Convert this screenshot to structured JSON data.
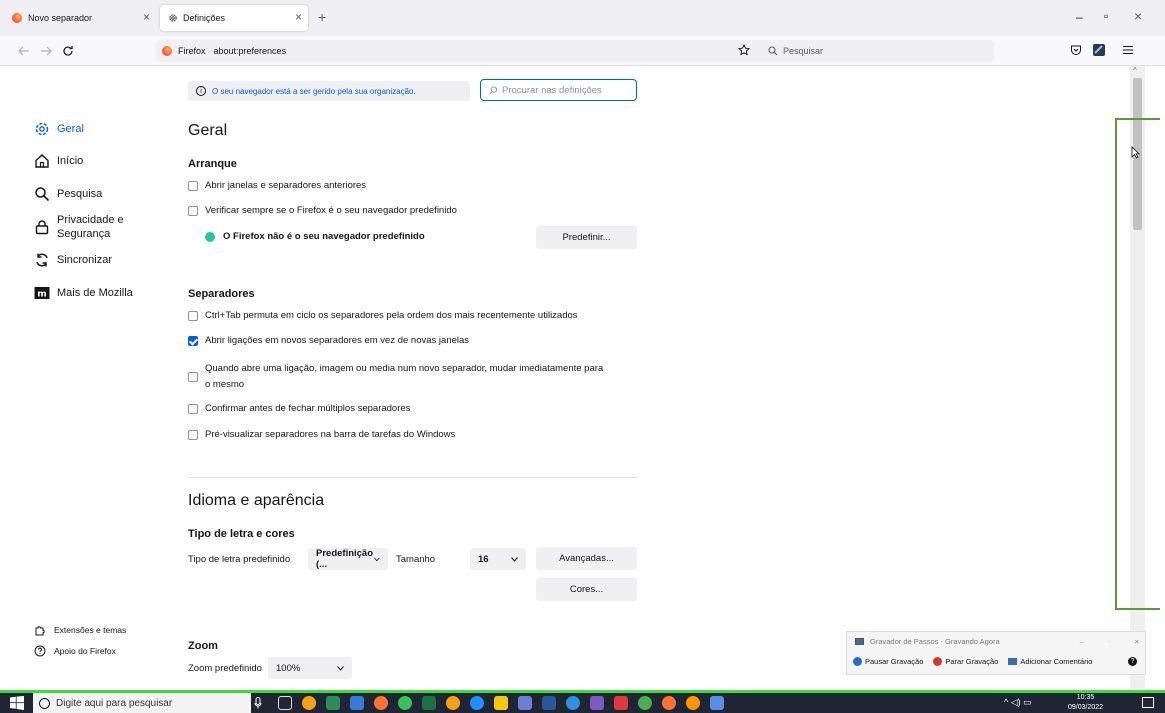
{
  "tabs": [
    {
      "label": "Novo separador",
      "close": "×"
    },
    {
      "label": "Definições",
      "close": "×"
    }
  ],
  "new_tab": "+",
  "window_controls": {
    "minimize": "–",
    "maximize": "▫",
    "close": "×"
  },
  "url": {
    "identity": "Firefox",
    "address": "about:preferences"
  },
  "search": {
    "placeholder": "Pesquisar"
  },
  "managed_notice": "O seu navegador está a ser gerido pela sua organização.",
  "settings_search": {
    "placeholder": "Procurar nas definições"
  },
  "sidebar": {
    "items": [
      {
        "label": "Geral",
        "icon": "gear-icon"
      },
      {
        "label": "Início",
        "icon": "home-icon"
      },
      {
        "label": "Pesquisa",
        "icon": "search-icon"
      },
      {
        "label": "Privacidade e",
        "label2": "Segurança",
        "icon": "lock-icon"
      },
      {
        "label": "Sincronizar",
        "icon": "sync-icon"
      },
      {
        "label": "Mais de Mozilla",
        "icon": "mozilla-icon"
      }
    ],
    "footer": [
      {
        "label": "Extensões e temas",
        "icon": "puzzle-icon"
      },
      {
        "label": "Apoio do Firefox",
        "icon": "help-icon"
      }
    ]
  },
  "general": {
    "title": "Geral",
    "startup": {
      "heading": "Arranque",
      "restore": "Abrir janelas e separadores anteriores",
      "check_default": "Verificar sempre se o Firefox é o seu navegador predefinido",
      "not_default": "O Firefox não é o seu navegador predefinido",
      "make_default": "Predefinir..."
    },
    "tabs": {
      "heading": "Separadores",
      "ctrl_tab": "Ctrl+Tab permuta em ciclo os separadores pela ordem dos mais recentemente utilizados",
      "open_links": "Abrir ligações em novos separadores em vez de novas janelas",
      "switch_line1": "Quando abre uma ligação, imagem ou media num novo separador, mudar imediatamente para",
      "switch_line2": "o mesmo",
      "confirm_close": "Confirmar antes de fechar múltiplos separadores",
      "preview": "Pré-visualizar separadores na barra de tarefas do Windows"
    }
  },
  "appearance": {
    "title": "Idioma e aparência",
    "fonts_heading": "Tipo de letra e cores",
    "default_font_label": "Tipo de letra predefinido",
    "default_font_value": "Predefinição (...",
    "size_label": "Tamanho",
    "size_value": "16",
    "advanced": "Avançadas...",
    "colors": "Cores..."
  },
  "zoom": {
    "heading": "Zoom",
    "default_label": "Zoom predefinido",
    "default_value": "100%"
  },
  "steps_recorder": {
    "title": "Gravador de Passos - Gravando Agora",
    "pause": "Pausar Gravação",
    "stop": "Parar Gravação",
    "comment": "Adicionar Comentário"
  },
  "taskbar": {
    "search_placeholder": "Digite aqui para pesquisar",
    "time": "10:35",
    "date": "09/03/2022"
  }
}
